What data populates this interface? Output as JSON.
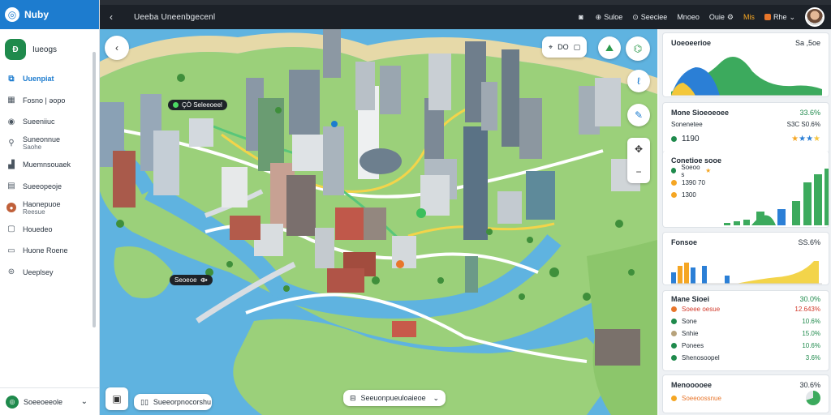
{
  "app": {
    "brand": "Nuby",
    "title": "Ueeba Uneenbgecenl"
  },
  "sidebar": {
    "account": {
      "badge": "Ð",
      "name": "Iueogs"
    },
    "items": [
      {
        "label": "Uuenpiat",
        "icon": "layers-icon",
        "active": true
      },
      {
        "label": "Fosno | ǝopo",
        "icon": "grid-icon"
      },
      {
        "label": "Sueeniiuc",
        "icon": "target-icon"
      },
      {
        "label": "Suneonnue",
        "sub": "Saohe",
        "icon": "pin-icon"
      },
      {
        "label": "Muemnsouaek",
        "icon": "chart-icon"
      },
      {
        "label": "Sueeopeoje",
        "icon": "document-icon"
      },
      {
        "label": "Haonepuoe",
        "sub": "Reesue",
        "icon": "user-icon"
      },
      {
        "label": "Houedeo",
        "icon": "clipboard-icon"
      },
      {
        "label": "Huone Roene",
        "icon": "folder-icon"
      },
      {
        "label": "Ueeplsey",
        "icon": "settings-icon"
      }
    ],
    "footer": {
      "label": "Soeeoeeole"
    }
  },
  "topbar": {
    "tools": [
      {
        "label": "",
        "icon": "camera-icon"
      },
      {
        "label": "Suloe",
        "icon": "globe-icon"
      },
      {
        "label": "Seeciee",
        "icon": "clock-icon"
      },
      {
        "label": "Mnoeo",
        "icon": ""
      },
      {
        "label": "Ouie",
        "icon": "gear-icon"
      },
      {
        "label": "Mis",
        "icon": "",
        "accent": true
      },
      {
        "label": "Rhe",
        "icon": "flag-icon"
      }
    ]
  },
  "map": {
    "labels": [
      {
        "text": "ÇÒ Seleeoeel",
        "id": "map-label-north"
      },
      {
        "text": "Seoeoe",
        "id": "map-label-west"
      }
    ],
    "toolbar_value": "DO",
    "bottom_pill": "Sueeorpnocorshu",
    "bottom_dropdown": "Seeuonpueuloaieoe",
    "colors": {
      "water": "#5fb3e0",
      "land": "#9bd07a",
      "road": "#ffffff",
      "route": "#f3d44a"
    }
  },
  "panel": {
    "card1": {
      "title": "Uoeoeerioe",
      "value": "Sa ,5oe"
    },
    "card2": {
      "title": "Mone Sioeoeoee",
      "title_value": "33.6%",
      "row1": {
        "label": "Sonenetee",
        "value": "S3C S0.6%"
      },
      "row2": {
        "label": "1190"
      },
      "rating": 3
    },
    "card3": {
      "title": "Conetioe sooe",
      "rows": [
        {
          "label": "Soeoo s",
          "color": "#1f8a4c"
        },
        {
          "label": "1390 70",
          "color": "#f5a623"
        },
        {
          "label": "1300",
          "color": "#f5a623"
        }
      ]
    },
    "card4": {
      "title": "Fonsoe",
      "value": "SS.6%"
    },
    "card5": {
      "title": "Mane Sioei",
      "title_value": "30.0%",
      "rows": [
        {
          "label": "Soeee oesue",
          "value": "12.643%",
          "color": "#e8762b",
          "tone": "red"
        },
        {
          "label": "Sone",
          "value": "10.6%",
          "color": "#1f8a4c",
          "tone": "green"
        },
        {
          "label": "Snhie",
          "value": "15.0%",
          "color": "#b7a27b",
          "tone": "green"
        },
        {
          "label": "Ponees",
          "value": "10.6%",
          "color": "#1f8a4c",
          "tone": "green"
        },
        {
          "label": "Shenosoopel",
          "value": "3.6%",
          "color": "#1f8a4c",
          "tone": "green"
        }
      ]
    },
    "card6": {
      "title": "Menooooee",
      "title_value": "30.6%",
      "row": "Soeeoossnue"
    }
  }
}
